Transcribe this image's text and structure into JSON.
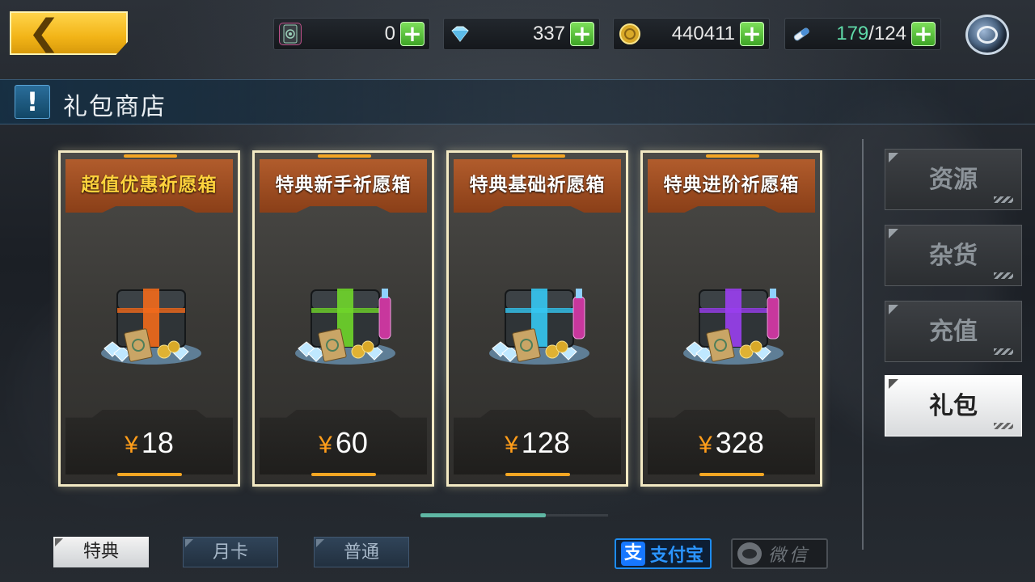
{
  "colors": {
    "accent_gold": "#f5a623",
    "price_yen": "#ff9d1a",
    "header_rust": "#b15c2c",
    "active_tab": "#ffffff",
    "alipay_blue": "#1677ff"
  },
  "topbar": {
    "back_icon": "chevron-left-icon",
    "currencies": [
      {
        "icon": "card-ticket-icon",
        "value": "0"
      },
      {
        "icon": "diamond-icon",
        "value": "337"
      },
      {
        "icon": "gold-coin-icon",
        "value": "440411"
      },
      {
        "icon": "stamina-icon",
        "value_current": "179",
        "value_sep": "/",
        "value_max": "124"
      }
    ],
    "settings_icon": "settings-ring-icon"
  },
  "title": {
    "icon_glyph": "!",
    "text": "礼包商店"
  },
  "cards": [
    {
      "name": "超值优惠祈愿箱",
      "currency_symbol": "¥",
      "price": "18",
      "chest_color": "#f26a1b"
    },
    {
      "name": "特典新手祈愿箱",
      "currency_symbol": "¥",
      "price": "60",
      "chest_color": "#6fd62a"
    },
    {
      "name": "特典基础祈愿箱",
      "currency_symbol": "¥",
      "price": "128",
      "chest_color": "#35c8f2"
    },
    {
      "name": "特典进阶祈愿箱",
      "currency_symbol": "¥",
      "price": "328",
      "chest_color": "#9a3ff0"
    }
  ],
  "side_tabs": [
    {
      "label": "资源",
      "active": false
    },
    {
      "label": "杂货",
      "active": false
    },
    {
      "label": "充值",
      "active": false
    },
    {
      "label": "礼包",
      "active": true
    }
  ],
  "bottom_tabs": [
    {
      "label": "特典",
      "active": true
    },
    {
      "label": "月卡",
      "active": false
    },
    {
      "label": "普通",
      "active": false
    }
  ],
  "payment": {
    "alipay_logo": "支",
    "alipay_label": "支付宝",
    "wechat_label": "微信"
  }
}
